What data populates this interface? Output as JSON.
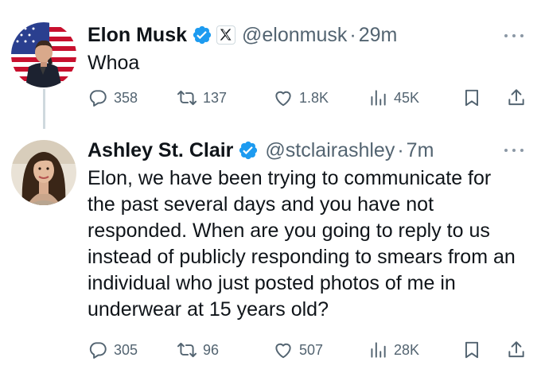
{
  "tweets": [
    {
      "author": {
        "name": "Elon Musk",
        "handle": "@elonmusk",
        "verified": true,
        "affiliate_badge": "x-logo-icon"
      },
      "separator": "·",
      "time": "29m",
      "text": "Whoa",
      "stats": {
        "replies": "358",
        "reposts": "137",
        "likes": "1.8K",
        "views": "45K"
      }
    },
    {
      "author": {
        "name": "Ashley St. Clair",
        "handle": "@stclairashley",
        "verified": true
      },
      "separator": "·",
      "time": "7m",
      "text": "Elon, we have been trying to communicate for the past several days and you have not responded. When are you going to reply to us instead of publicly responding to smears from an individual who just posted photos of me in underwear at 15 years old?",
      "stats": {
        "replies": "305",
        "reposts": "96",
        "likes": "507",
        "views": "28K"
      }
    }
  ],
  "colors": {
    "text_primary": "#0f1419",
    "text_secondary": "#536471",
    "verified_blue": "#1d9bf0",
    "thread_line": "#cfd9de"
  }
}
